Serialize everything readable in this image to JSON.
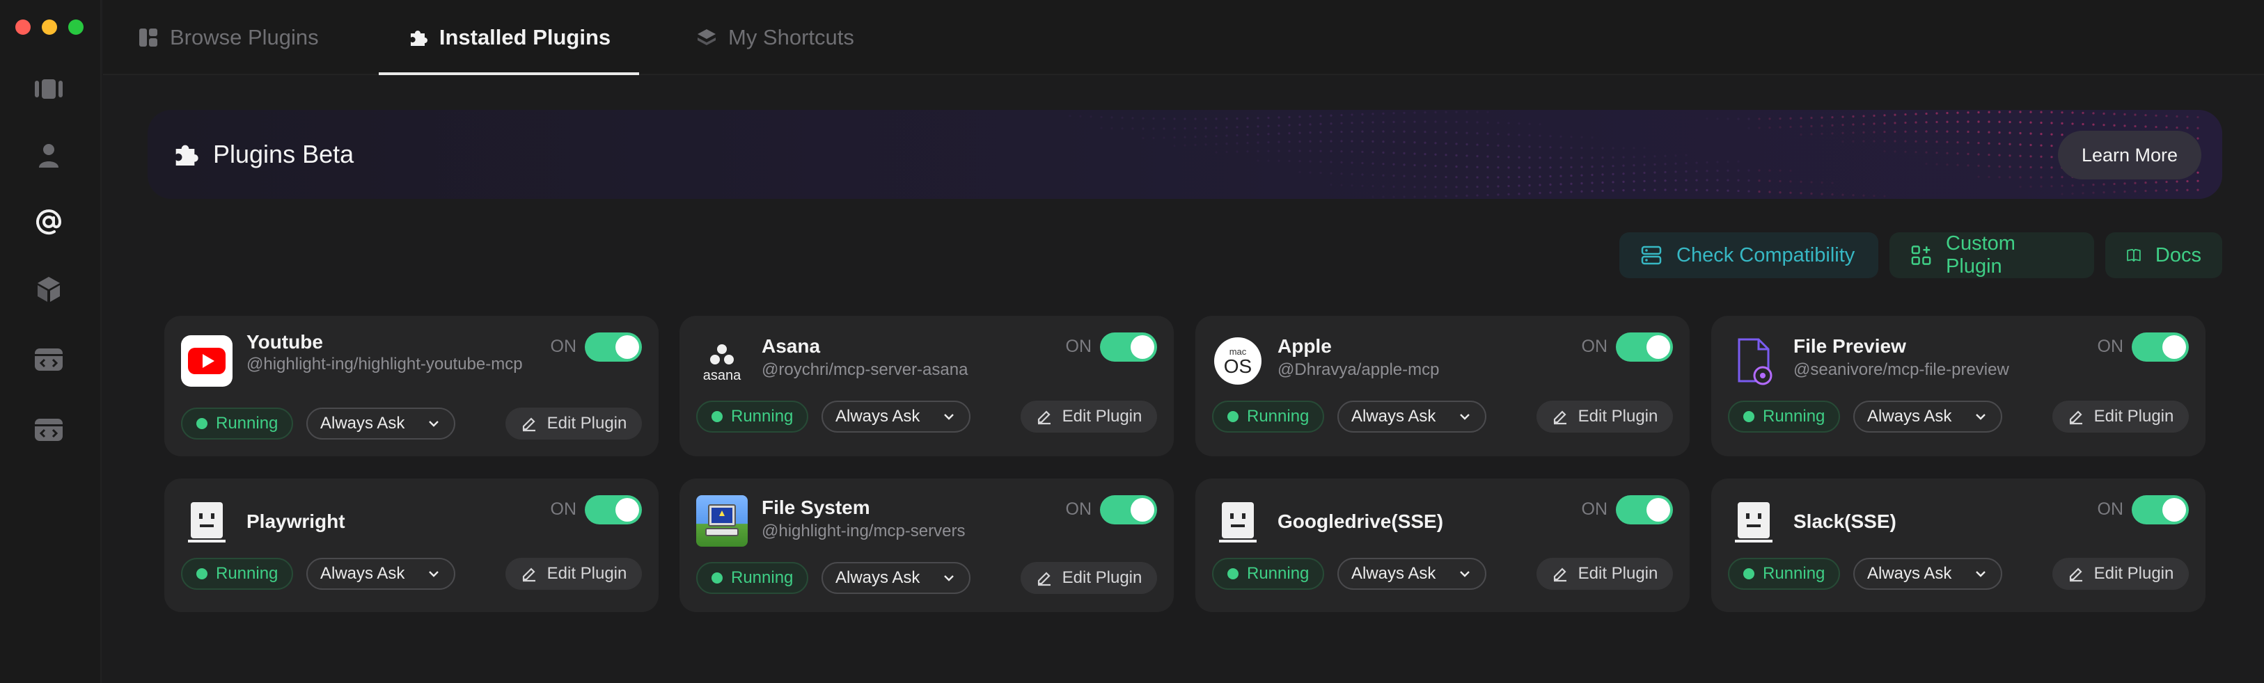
{
  "tabs": [
    {
      "label": "Browse Plugins",
      "icon": "grid-icon",
      "active": false
    },
    {
      "label": "Installed Plugins",
      "icon": "puzzle-icon",
      "active": true
    },
    {
      "label": "My Shortcuts",
      "icon": "stack-icon",
      "active": false
    }
  ],
  "banner": {
    "title": "Plugins Beta",
    "cta": "Learn More"
  },
  "actions": {
    "check_compat": "Check Compatibility",
    "custom_plugin": "Custom Plugin",
    "docs": "Docs"
  },
  "colors": {
    "accent_green": "#3fcf86",
    "accent_teal": "#37b8c4",
    "background": "#1c1c1d"
  },
  "plugins": [
    {
      "name": "Youtube",
      "handle": "@highlight-ing/highlight-youtube-mcp",
      "on_label": "ON",
      "enabled": true,
      "status": "Running",
      "permission": "Always Ask",
      "edit": "Edit Plugin",
      "icon": "youtube-icon"
    },
    {
      "name": "Asana",
      "handle": "@roychri/mcp-server-asana",
      "on_label": "ON",
      "enabled": true,
      "status": "Running",
      "permission": "Always Ask",
      "edit": "Edit Plugin",
      "icon": "asana-icon",
      "icon_text": "asana"
    },
    {
      "name": "Apple",
      "handle": "@Dhravya/apple-mcp",
      "on_label": "ON",
      "enabled": true,
      "status": "Running",
      "permission": "Always Ask",
      "edit": "Edit Plugin",
      "icon": "macos-icon",
      "icon_text": "mac",
      "icon_text2": "OS"
    },
    {
      "name": "File Preview",
      "handle": "@seanivore/mcp-file-preview",
      "on_label": "ON",
      "enabled": true,
      "status": "Running",
      "permission": "Always Ask",
      "edit": "Edit Plugin",
      "icon": "file-preview-icon"
    },
    {
      "name": "Playwright",
      "handle": "",
      "on_label": "ON",
      "enabled": true,
      "status": "Running",
      "permission": "Always Ask",
      "edit": "Edit Plugin",
      "icon": "robot-face-icon"
    },
    {
      "name": "File System",
      "handle": "@highlight-ing/mcp-servers",
      "on_label": "ON",
      "enabled": true,
      "status": "Running",
      "permission": "Always Ask",
      "edit": "Edit Plugin",
      "icon": "computer-icon"
    },
    {
      "name": "Googledrive(SSE)",
      "handle": "",
      "on_label": "ON",
      "enabled": true,
      "status": "Running",
      "permission": "Always Ask",
      "edit": "Edit Plugin",
      "icon": "robot-face-icon"
    },
    {
      "name": "Slack(SSE)",
      "handle": "",
      "on_label": "ON",
      "enabled": true,
      "status": "Running",
      "permission": "Always Ask",
      "edit": "Edit Plugin",
      "icon": "robot-face-icon"
    }
  ]
}
